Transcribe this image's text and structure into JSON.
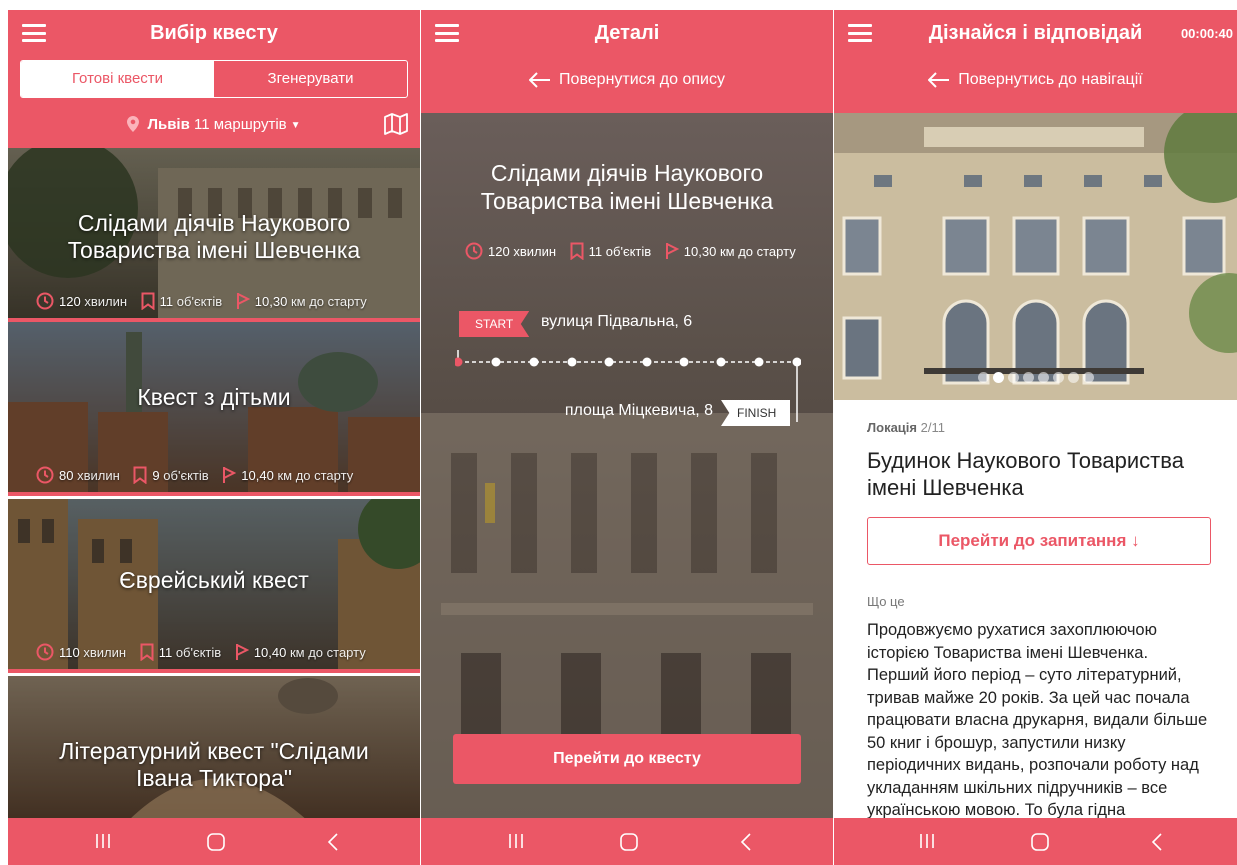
{
  "colors": {
    "accent": "#eb5766",
    "white": "#ffffff"
  },
  "screen1": {
    "title": "Вибір квесту",
    "tabs": {
      "ready": "Готові квести",
      "generate": "Згенерувати"
    },
    "city": {
      "name": "Львів",
      "routes": "11 маршрутів"
    },
    "quests": [
      {
        "title": "Слідами діячів Наукового Товариства імені Шевченка",
        "minutes": "120",
        "minutes_label": "хвилин",
        "objects": "11",
        "objects_label": "об'єктів",
        "distance": "10,30",
        "distance_label": "км до старту"
      },
      {
        "title": "Квест з дітьми",
        "minutes": "80",
        "minutes_label": "хвилин",
        "objects": "9",
        "objects_label": "об'єктів",
        "distance": "10,40",
        "distance_label": "км до старту"
      },
      {
        "title": "Єврейський квест",
        "minutes": "110",
        "minutes_label": "хвилин",
        "objects": "11",
        "objects_label": "об'єктів",
        "distance": "10,40",
        "distance_label": "км до старту"
      },
      {
        "title": "Літературний квест \"Слідами Івана Тиктора\""
      }
    ]
  },
  "screen2": {
    "title": "Деталі",
    "back": "Повернутися до опису",
    "quest_title": "Слідами діячів Наукового Товариства імені Шевченка",
    "minutes": "120",
    "minutes_label": "хвилин",
    "objects": "11",
    "objects_label": "об'єктів",
    "distance": "10,30",
    "distance_label": "км до старту",
    "start_label": "START",
    "start_address": "вулиця Підвальна, 6",
    "finish_label": "FINISH",
    "finish_address": "площа Міцкевича, 8",
    "go_button": "Перейти до квесту"
  },
  "screen3": {
    "title": "Дізнайся і відповідай",
    "timer": "00:00:40",
    "back": "Повернутись до навігації",
    "location_label": "Локація",
    "location_index": "2/11",
    "object_title": "Будинок Наукового Товариства імені Шевченка",
    "question_button": "Перейти до запитання ↓",
    "section_label": "Що це",
    "body": "Продовжуємо рухатися захоплюючою історією Товариства імені Шевченка. Перший його період – суто літературний, тривав майже 20 років. За цей час почала працювати власна друкарня, видали більше 50 книг і брошур, запустили низку періодичних видань, розпочали роботу над укладанням шкільних підручників – все українською мовою. То була гідна"
  }
}
